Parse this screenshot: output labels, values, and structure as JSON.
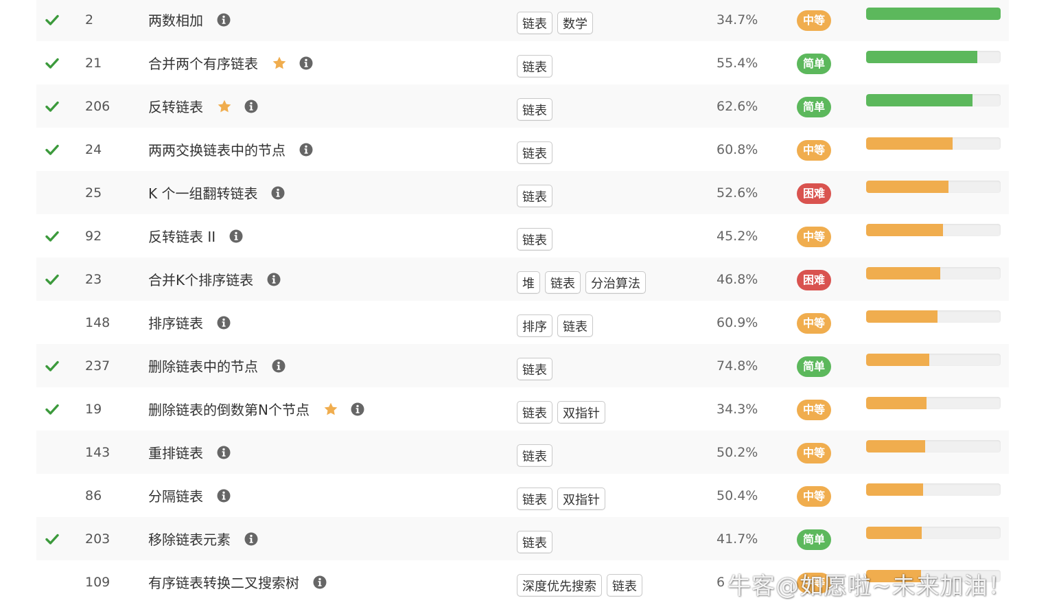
{
  "rows": [
    {
      "solved": true,
      "id": "2",
      "title": "两数相加",
      "starred": false,
      "tags": [
        "链表",
        "数学"
      ],
      "rate": "34.7%",
      "difficulty": "中等",
      "level": "mid",
      "progress": 1.0,
      "bar": "green"
    },
    {
      "solved": true,
      "id": "21",
      "title": "合并两个有序链表",
      "starred": true,
      "tags": [
        "链表"
      ],
      "rate": "55.4%",
      "difficulty": "简单",
      "level": "easy",
      "progress": 0.825,
      "bar": "green"
    },
    {
      "solved": true,
      "id": "206",
      "title": "反转链表",
      "starred": true,
      "tags": [
        "链表"
      ],
      "rate": "62.6%",
      "difficulty": "简单",
      "level": "easy",
      "progress": 0.79,
      "bar": "green"
    },
    {
      "solved": true,
      "id": "24",
      "title": "两两交换链表中的节点",
      "starred": false,
      "tags": [
        "链表"
      ],
      "rate": "60.8%",
      "difficulty": "中等",
      "level": "mid",
      "progress": 0.645,
      "bar": "orange"
    },
    {
      "solved": false,
      "id": "25",
      "title": "K 个一组翻转链表",
      "starred": false,
      "tags": [
        "链表"
      ],
      "rate": "52.6%",
      "difficulty": "困难",
      "level": "hard",
      "progress": 0.61,
      "bar": "orange"
    },
    {
      "solved": true,
      "id": "92",
      "title": "反转链表 II",
      "starred": false,
      "tags": [
        "链表"
      ],
      "rate": "45.2%",
      "difficulty": "中等",
      "level": "mid",
      "progress": 0.57,
      "bar": "orange"
    },
    {
      "solved": true,
      "id": "23",
      "title": "合并K个排序链表",
      "starred": false,
      "tags": [
        "堆",
        "链表",
        "分治算法"
      ],
      "rate": "46.8%",
      "difficulty": "困难",
      "level": "hard",
      "progress": 0.55,
      "bar": "orange"
    },
    {
      "solved": false,
      "id": "148",
      "title": "排序链表",
      "starred": false,
      "tags": [
        "排序",
        "链表"
      ],
      "rate": "60.9%",
      "difficulty": "中等",
      "level": "mid",
      "progress": 0.53,
      "bar": "orange"
    },
    {
      "solved": true,
      "id": "237",
      "title": "删除链表中的节点",
      "starred": false,
      "tags": [
        "链表"
      ],
      "rate": "74.8%",
      "difficulty": "简单",
      "level": "easy",
      "progress": 0.47,
      "bar": "orange"
    },
    {
      "solved": true,
      "id": "19",
      "title": "删除链表的倒数第N个节点",
      "starred": true,
      "tags": [
        "链表",
        "双指针"
      ],
      "rate": "34.3%",
      "difficulty": "中等",
      "level": "mid",
      "progress": 0.45,
      "bar": "orange"
    },
    {
      "solved": false,
      "id": "143",
      "title": "重排链表",
      "starred": false,
      "tags": [
        "链表"
      ],
      "rate": "50.2%",
      "difficulty": "中等",
      "level": "mid",
      "progress": 0.44,
      "bar": "orange"
    },
    {
      "solved": false,
      "id": "86",
      "title": "分隔链表",
      "starred": false,
      "tags": [
        "链表",
        "双指针"
      ],
      "rate": "50.4%",
      "difficulty": "中等",
      "level": "mid",
      "progress": 0.425,
      "bar": "orange"
    },
    {
      "solved": true,
      "id": "203",
      "title": "移除链表元素",
      "starred": false,
      "tags": [
        "链表"
      ],
      "rate": "41.7%",
      "difficulty": "简单",
      "level": "easy",
      "progress": 0.415,
      "bar": "orange"
    },
    {
      "solved": false,
      "id": "109",
      "title": "有序链表转换二叉搜索树",
      "starred": false,
      "tags": [
        "深度优先搜索",
        "链表"
      ],
      "rate": "6",
      "difficulty": "中等",
      "level": "mid",
      "progress": 0.41,
      "bar": "orange"
    }
  ],
  "icons": {
    "check": "check-icon",
    "star": "star-icon",
    "info": "info-icon"
  },
  "colors": {
    "green": "#5cb85c",
    "orange": "#f0ad4e",
    "red": "#d9534f",
    "check": "#3c9a3c",
    "star": "#f0ad4e",
    "info": "#666666"
  },
  "watermark": "牛客@如愿啦~未来加油！"
}
